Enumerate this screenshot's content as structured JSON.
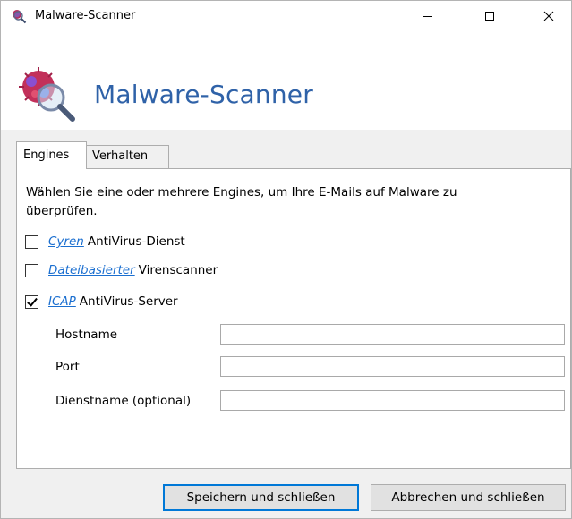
{
  "window": {
    "title": "Malware-Scanner",
    "icon": "virus-magnifier-icon"
  },
  "header": {
    "heading": "Malware-Scanner",
    "icon": "virus-magnifier-icon",
    "heading_color": "#2f62a8"
  },
  "tabs": [
    {
      "label": "Engines",
      "active": true
    },
    {
      "label": "Verhalten",
      "active": false
    }
  ],
  "engines": {
    "description": "Wählen Sie eine oder mehrere Engines, um Ihre E-Mails auf Malware zu überprüfen.",
    "options": [
      {
        "link": "Cyren",
        "label": "AntiVirus-Dienst",
        "checked": false
      },
      {
        "link": "Dateibasierter",
        "label": "Virenscanner",
        "checked": false
      },
      {
        "link": "ICAP",
        "label": "AntiVirus-Server",
        "checked": true
      }
    ],
    "fields": [
      {
        "label": "Hostname",
        "value": ""
      },
      {
        "label": "Port",
        "value": ""
      },
      {
        "label": "Dienstname (optional)",
        "value": ""
      }
    ]
  },
  "buttons": {
    "save": "Speichern und schließen",
    "cancel": "Abbrechen und schließen"
  },
  "colors": {
    "link": "#1b6fd0",
    "accent": "#0078d7"
  }
}
